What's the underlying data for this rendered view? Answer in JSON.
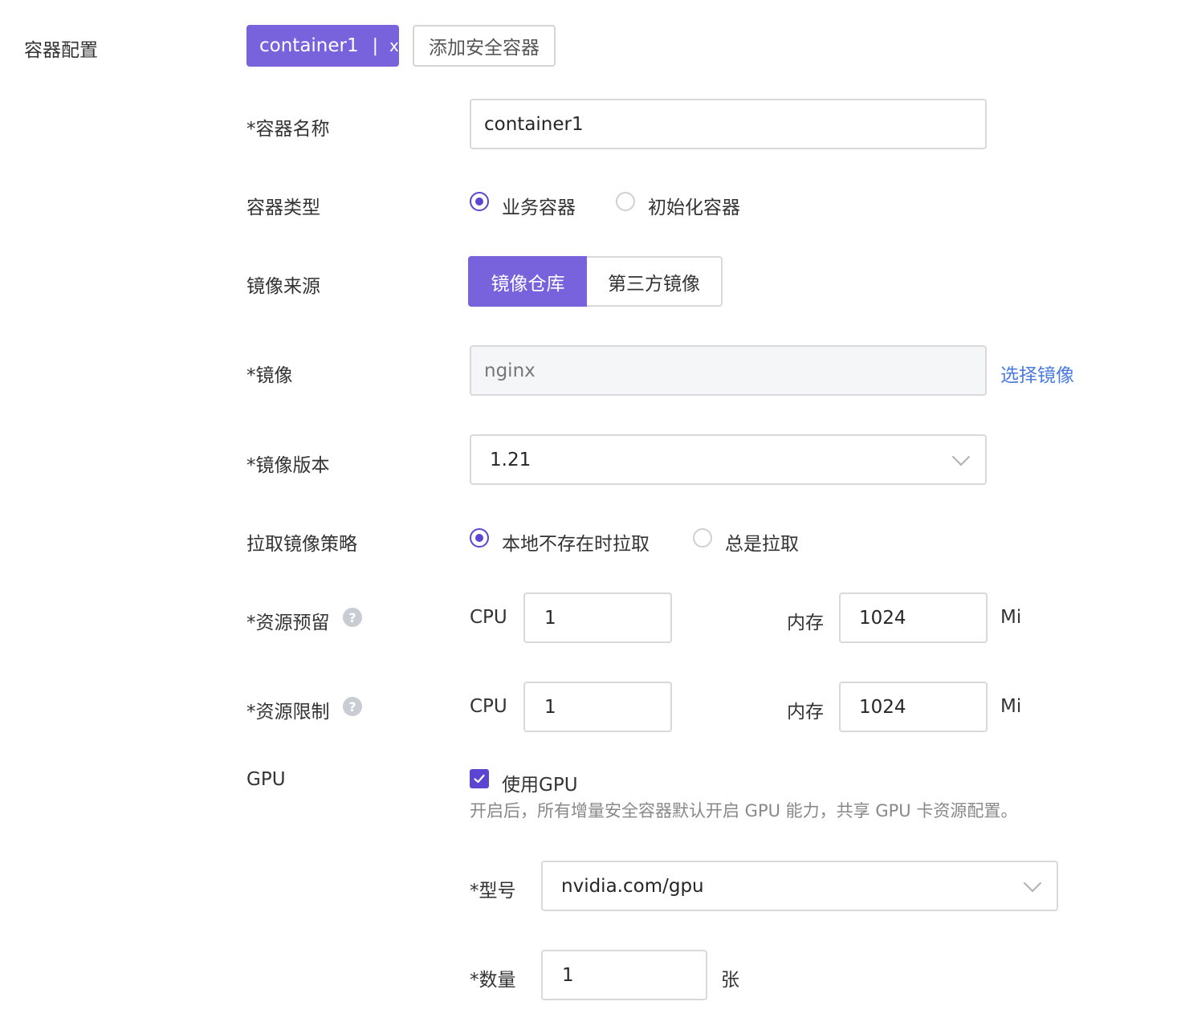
{
  "section_label": "容器配置",
  "tabs": {
    "active_label": "container1",
    "separator": "|",
    "close_glyph": "x",
    "add_label": "添加安全容器"
  },
  "fields": {
    "name": {
      "label": "*容器名称",
      "value": "container1"
    },
    "type": {
      "label": "容器类型",
      "options": [
        "业务容器",
        "初始化容器"
      ],
      "selected": "业务容器"
    },
    "image_source": {
      "label": "镜像来源",
      "options": [
        "镜像仓库",
        "第三方镜像"
      ],
      "selected": "镜像仓库"
    },
    "image": {
      "label": "*镜像",
      "value": "nginx",
      "action": "选择镜像"
    },
    "image_version": {
      "label": "*镜像版本",
      "value": "1.21"
    },
    "pull_policy": {
      "label": "拉取镜像策略",
      "options": [
        "本地不存在时拉取",
        "总是拉取"
      ],
      "selected": "本地不存在时拉取"
    },
    "resource_request": {
      "label": "*资源预留",
      "help": "?",
      "cpu_label": "CPU",
      "cpu_value": "1",
      "mem_label": "内存",
      "mem_value": "1024",
      "mem_unit": "Mi"
    },
    "resource_limit": {
      "label": "*资源限制",
      "help": "?",
      "cpu_label": "CPU",
      "cpu_value": "1",
      "mem_label": "内存",
      "mem_value": "1024",
      "mem_unit": "Mi"
    },
    "gpu": {
      "label": "GPU",
      "checkbox_label": "使用GPU",
      "checked": true,
      "hint": "开启后，所有增量安全容器默认开启 GPU 能力，共享 GPU 卡资源配置。",
      "model_label": "*型号",
      "model_value": "nvidia.com/gpu",
      "count_label": "*数量",
      "count_value": "1",
      "count_unit": "张"
    }
  },
  "colors": {
    "primary": "#7863dc",
    "radio_checked": "#5b45d3",
    "link": "#4a7be0",
    "border": "#d9d9d9",
    "disabled_bg": "#f5f6f8"
  }
}
